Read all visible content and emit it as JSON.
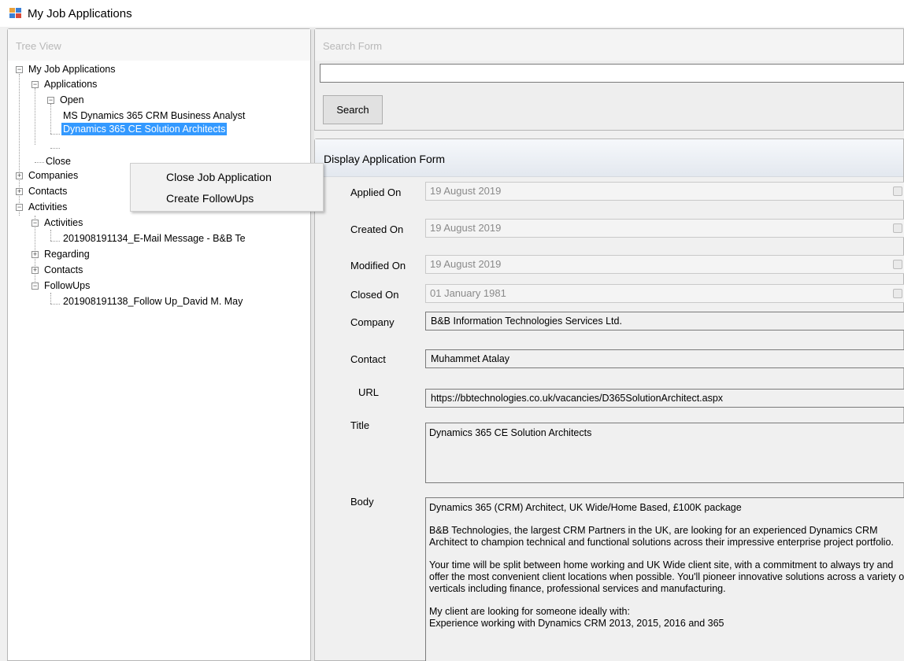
{
  "window": {
    "title": "My Job Applications"
  },
  "tree_panel": {
    "caption": "Tree View"
  },
  "tree": {
    "root": "My Job Applications",
    "applications": "Applications",
    "open": "Open",
    "open_item_1": "MS Dynamics 365 CRM Business Analyst",
    "open_item_2": "Dynamics 365 CE Solution Architects",
    "close": "Close",
    "companies": "Companies",
    "contacts": "Contacts",
    "activities": "Activities",
    "activities_sub": "Activities",
    "activity_item": "201908191134_E-Mail Message - B&B Te",
    "regarding": "Regarding",
    "contacts_sub": "Contacts",
    "followups": "FollowUps",
    "followup_item": "201908191138_Follow Up_David M. May"
  },
  "context_menu": {
    "items": [
      "Close Job Application",
      "Create FollowUps"
    ]
  },
  "search": {
    "caption": "Search Form",
    "value": "",
    "button_label": "Search"
  },
  "display": {
    "caption": "Display Application Form",
    "applied_on": {
      "label": "Applied On",
      "value": "19   August   2019"
    },
    "created_on": {
      "label": "Created On",
      "value": "19   August   2019"
    },
    "modified_on": {
      "label": "Modified On",
      "value": "19   August   2019"
    },
    "closed_on": {
      "label": "Closed On",
      "value": "01   January   1981"
    },
    "company": {
      "label": "Company",
      "value": "B&B Information Technologies Services Ltd."
    },
    "contact": {
      "label": "Contact",
      "value": "Muhammet Atalay"
    },
    "url": {
      "label": "URL",
      "value": "https://bbtechnologies.co.uk/vacancies/D365SolutionArchitect.aspx"
    },
    "title": {
      "label": "Title",
      "value": "Dynamics 365 CE Solution Architects"
    },
    "body": {
      "label": "Body",
      "paragraphs": [
        "Dynamics 365 (CRM) Architect, UK Wide/Home Based, £100K package",
        "B&B Technologies, the largest CRM Partners in the UK, are looking for an experienced Dynamics CRM Architect to champion technical and functional solutions across their impressive enterprise project portfolio.",
        "Your time will be split between home working and UK Wide client site, with a commitment to always try and offer the most convenient client locations when possible. You'll pioneer innovative solutions across a variety of verticals including finance, professional services and manufacturing.",
        "My client are looking for someone ideally with:\nExperience working with Dynamics CRM 2013, 2015, 2016 and 365"
      ]
    }
  }
}
